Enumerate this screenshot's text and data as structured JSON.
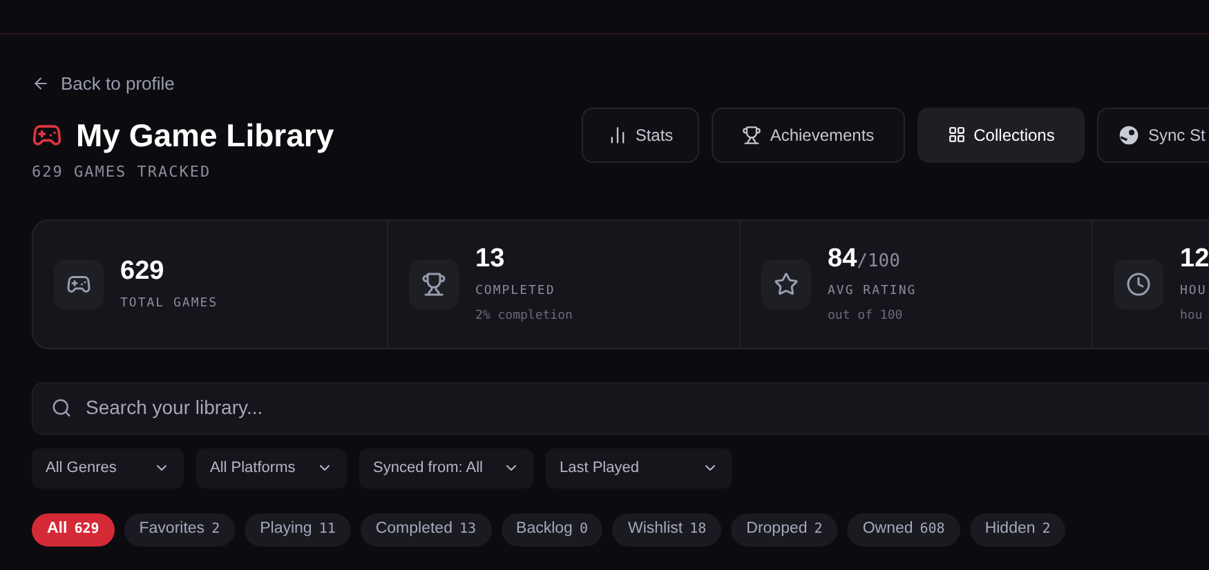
{
  "back_link": "Back to profile",
  "title": "My Game Library",
  "subtitle": "629 GAMES TRACKED",
  "actions": [
    {
      "label": "Stats",
      "selected": false
    },
    {
      "label": "Achievements",
      "selected": false
    },
    {
      "label": "Collections",
      "selected": true
    },
    {
      "label": "Sync St",
      "selected": false
    }
  ],
  "stats": [
    {
      "value": "629",
      "label": "TOTAL GAMES"
    },
    {
      "value": "13",
      "label": "COMPLETED",
      "note": "2% completion"
    },
    {
      "value": "84",
      "suffix": "/100",
      "label": "AVG RATING",
      "note": "out of 100"
    },
    {
      "value": "12",
      "label": "HOU",
      "note": "hou"
    }
  ],
  "search": {
    "placeholder": "Search your library..."
  },
  "filters": [
    "All Genres",
    "All Platforms",
    "Synced from: All",
    "Last Played"
  ],
  "chips": [
    {
      "label": "All",
      "count": "629",
      "selected": true
    },
    {
      "label": "Favorites",
      "count": "2",
      "selected": false
    },
    {
      "label": "Playing",
      "count": "11",
      "selected": false
    },
    {
      "label": "Completed",
      "count": "13",
      "selected": false
    },
    {
      "label": "Backlog",
      "count": "0",
      "selected": false
    },
    {
      "label": "Wishlist",
      "count": "18",
      "selected": false
    },
    {
      "label": "Dropped",
      "count": "2",
      "selected": false
    },
    {
      "label": "Owned",
      "count": "608",
      "selected": false
    },
    {
      "label": "Hidden",
      "count": "2",
      "selected": false
    }
  ]
}
